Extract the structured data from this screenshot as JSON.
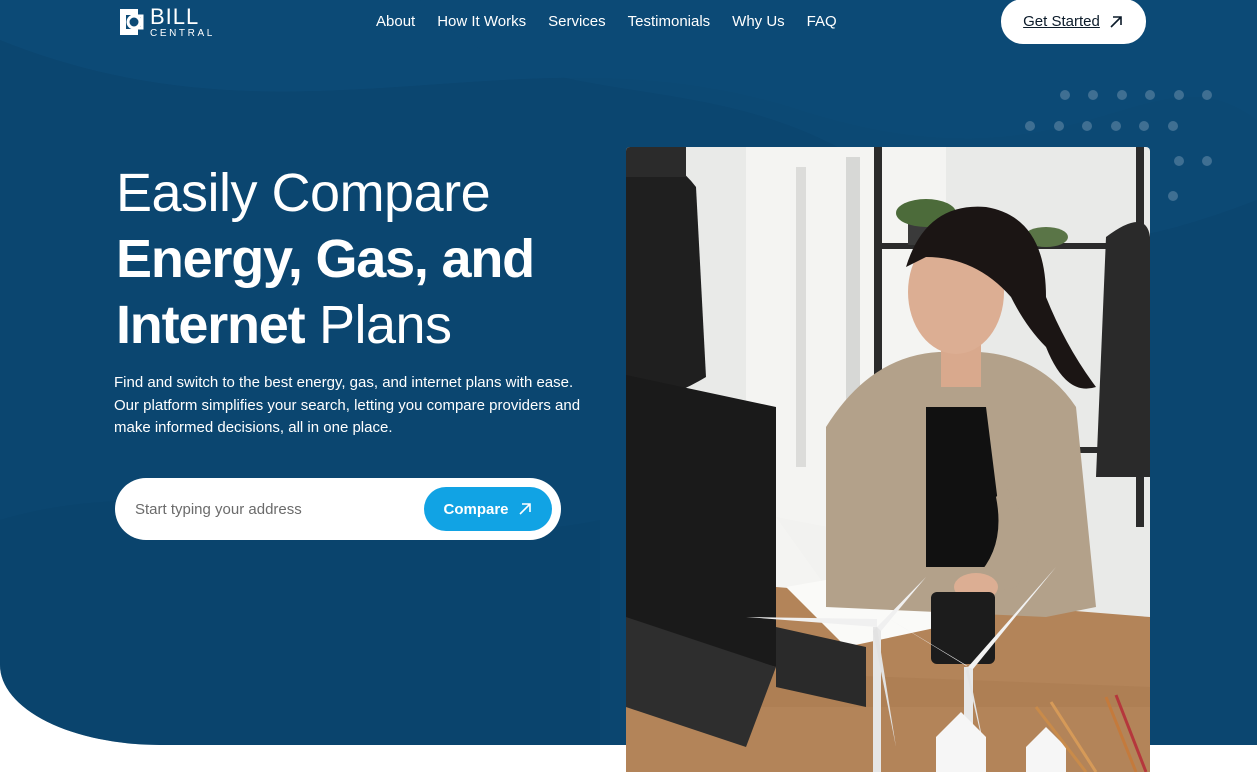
{
  "brand": {
    "name_line1": "BILL",
    "name_line2": "CENTRAL",
    "icon": "bill-central-logo-icon"
  },
  "nav": {
    "items": [
      {
        "label": "About"
      },
      {
        "label": "How It Works"
      },
      {
        "label": "Services"
      },
      {
        "label": "Testimonials"
      },
      {
        "label": "Why Us"
      },
      {
        "label": "FAQ"
      }
    ],
    "cta_label": "Get Started",
    "cta_icon": "arrow-up-right-icon"
  },
  "hero": {
    "headline_line1": "Easily Compare",
    "headline_line2": "Energy, Gas, and",
    "headline_line3_bold": "Internet",
    "headline_line3_regular": "Plans",
    "description": "Find and switch to the best energy, gas, and internet plans with ease. Our platform simplifies your search, letting you compare providers and make informed decisions, all in one place.",
    "search_placeholder": "Start typing your address",
    "compare_label": "Compare",
    "compare_icon": "arrow-up-right-icon",
    "image": "woman-at-desk-with-computer-and-wind-turbine-models-photo"
  },
  "colors": {
    "hero_bg": "#0b4670",
    "accent": "#11a3e4",
    "text_light": "#ffffff",
    "text_dark": "#0c1b2a"
  }
}
